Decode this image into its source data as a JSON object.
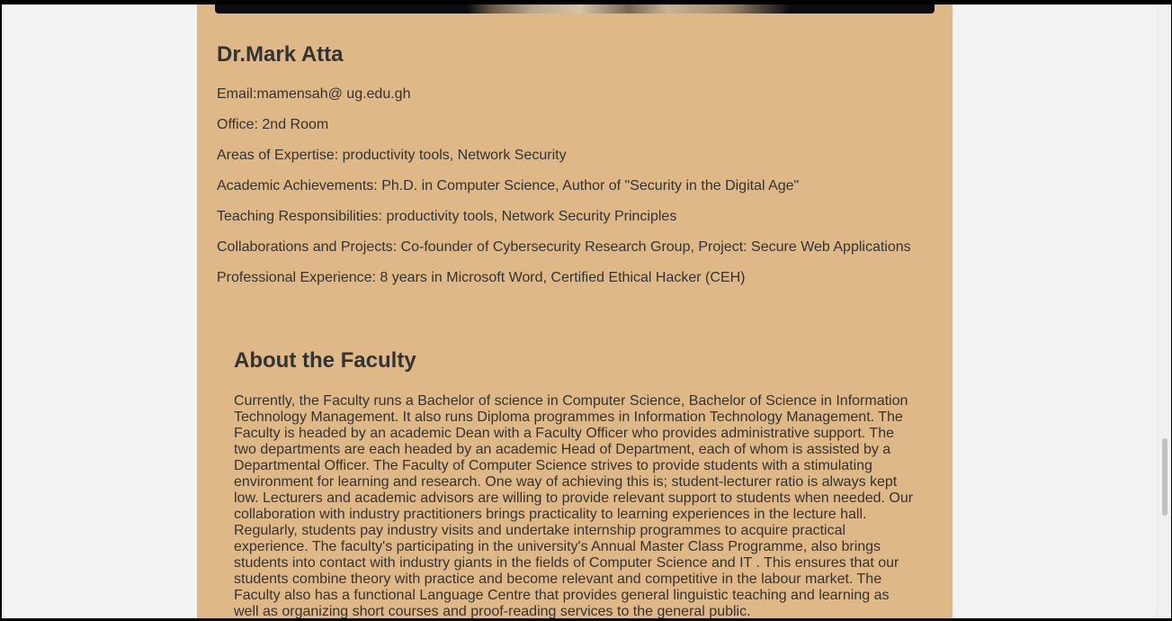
{
  "profile": {
    "name": "Dr.Mark Atta",
    "email": "Email:mamensah@ ug.edu.gh",
    "office": "Office: 2nd Room",
    "expertise": "Areas of Expertise: productivity tools, Network Security",
    "achievements": "Academic Achievements: Ph.D. in Computer Science, Author of \"Security in the Digital Age\"",
    "teaching": "Teaching Responsibilities: productivity tools, Network Security Principles",
    "collaborations": "Collaborations and Projects: Co-founder of Cybersecurity Research Group, Project: Secure Web Applications",
    "experience": "Professional Experience: 8 years in Microsoft Word, Certified Ethical Hacker (CEH)"
  },
  "about": {
    "title": "About the Faculty",
    "text": "Currently, the Faculty runs a Bachelor of science in Computer Science, Bachelor of Science in Information Technology Management. It also runs Diploma programmes in Information Technology Management. The Faculty is headed by an academic Dean with a Faculty Officer who provides administrative support. The two departments are each headed by an academic Head of Department, each of whom is assisted by a Departmental Officer. The Faculty of Computer Science strives to provide students with a stimulating environment for learning and research. One way of achieving this is; student-lecturer ratio is always kept low. Lecturers and academic advisors are willing to provide relevant support to students when needed. Our collaboration with industry practitioners brings practicality to learning experiences in the lecture hall. Regularly, students pay industry visits and undertake internship programmes to acquire practical experience. The faculty's participating in the university's Annual Master Class Programme, also brings students into contact with industry giants in the fields of Computer Science and IT . This ensures that our students combine theory with practice and become relevant and competitive in the labour market. The Faculty also has a functional Language Centre that provides general linguistic teaching and learning as well as organizing short courses and proof-reading services to the general public."
  },
  "colors": {
    "card_background": "#deb887",
    "page_background": "#f3f3f3",
    "text": "#333333"
  }
}
